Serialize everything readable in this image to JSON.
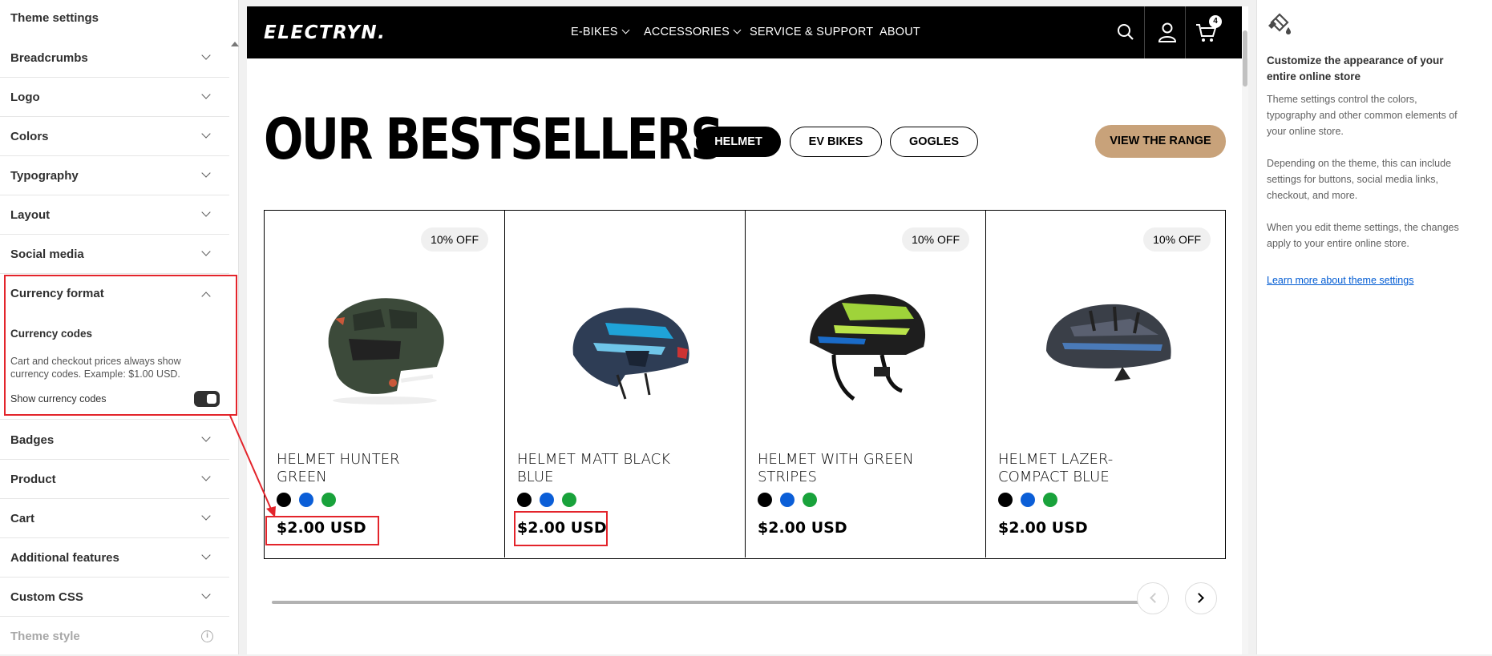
{
  "left_panel": {
    "title": "Theme settings",
    "sections_top": [
      {
        "label": "Breadcrumbs"
      },
      {
        "label": "Logo"
      },
      {
        "label": "Colors"
      },
      {
        "label": "Typography"
      },
      {
        "label": "Layout"
      },
      {
        "label": "Social media"
      }
    ],
    "currency": {
      "label": "Currency format",
      "sub_heading": "Currency codes",
      "description": "Cart and checkout prices always show currency codes. Example: $1.00 USD.",
      "toggle_label": "Show currency codes",
      "toggle_on": true
    },
    "sections_bottom": [
      {
        "label": "Badges"
      },
      {
        "label": "Product"
      },
      {
        "label": "Cart"
      },
      {
        "label": "Additional features"
      },
      {
        "label": "Custom CSS"
      }
    ],
    "theme_style": {
      "label": "Theme style",
      "icon": "info-icon"
    }
  },
  "store": {
    "logo": "ELECTRYN.",
    "nav": [
      "E-BIKES",
      "ACCESSORIES",
      "SERVICE & SUPPORT",
      "ABOUT"
    ],
    "cart_count": "4",
    "heading": "OUR BESTSELLERS",
    "tabs": [
      {
        "label": "HELMET",
        "active": true
      },
      {
        "label": "EV BIKES",
        "active": false
      },
      {
        "label": "GOGLES",
        "active": false
      }
    ],
    "cta": "VIEW THE RANGE",
    "products": [
      {
        "name": "HELMET HUNTER GREEN",
        "price": "$2.00 USD",
        "badge": "10% OFF",
        "helmet_color": "#3a4a38"
      },
      {
        "name": "HELMET MATT BLACK BLUE",
        "price": "$2.00 USD",
        "badge": "",
        "helmet_color": "#2a3a52"
      },
      {
        "name": "HELMET WITH GREEN STRIPES",
        "price": "$2.00 USD",
        "badge": "10% OFF",
        "helmet_color": "#1e1e1e"
      },
      {
        "name": "HELMET LAZER-COMPACT BLUE",
        "price": "$2.00 USD",
        "badge": "10% OFF",
        "helmet_color": "#3c4048"
      }
    ],
    "swatch_colors": [
      "#000000",
      "#0b5ed7",
      "#19a23b"
    ]
  },
  "right_panel": {
    "title": "Customize the appearance of your entire online store",
    "para1": "Theme settings control the colors, typography and other common elements of your online store.",
    "para2": "Depending on the theme, this can include settings for buttons, social media links, checkout, and more.",
    "para3": "When you edit theme settings, the changes apply to your entire online store.",
    "link": "Learn more about theme settings"
  },
  "colors": {
    "highlight": "#e3242b",
    "cta_bg": "#c8a27a",
    "link": "#005bd3"
  }
}
